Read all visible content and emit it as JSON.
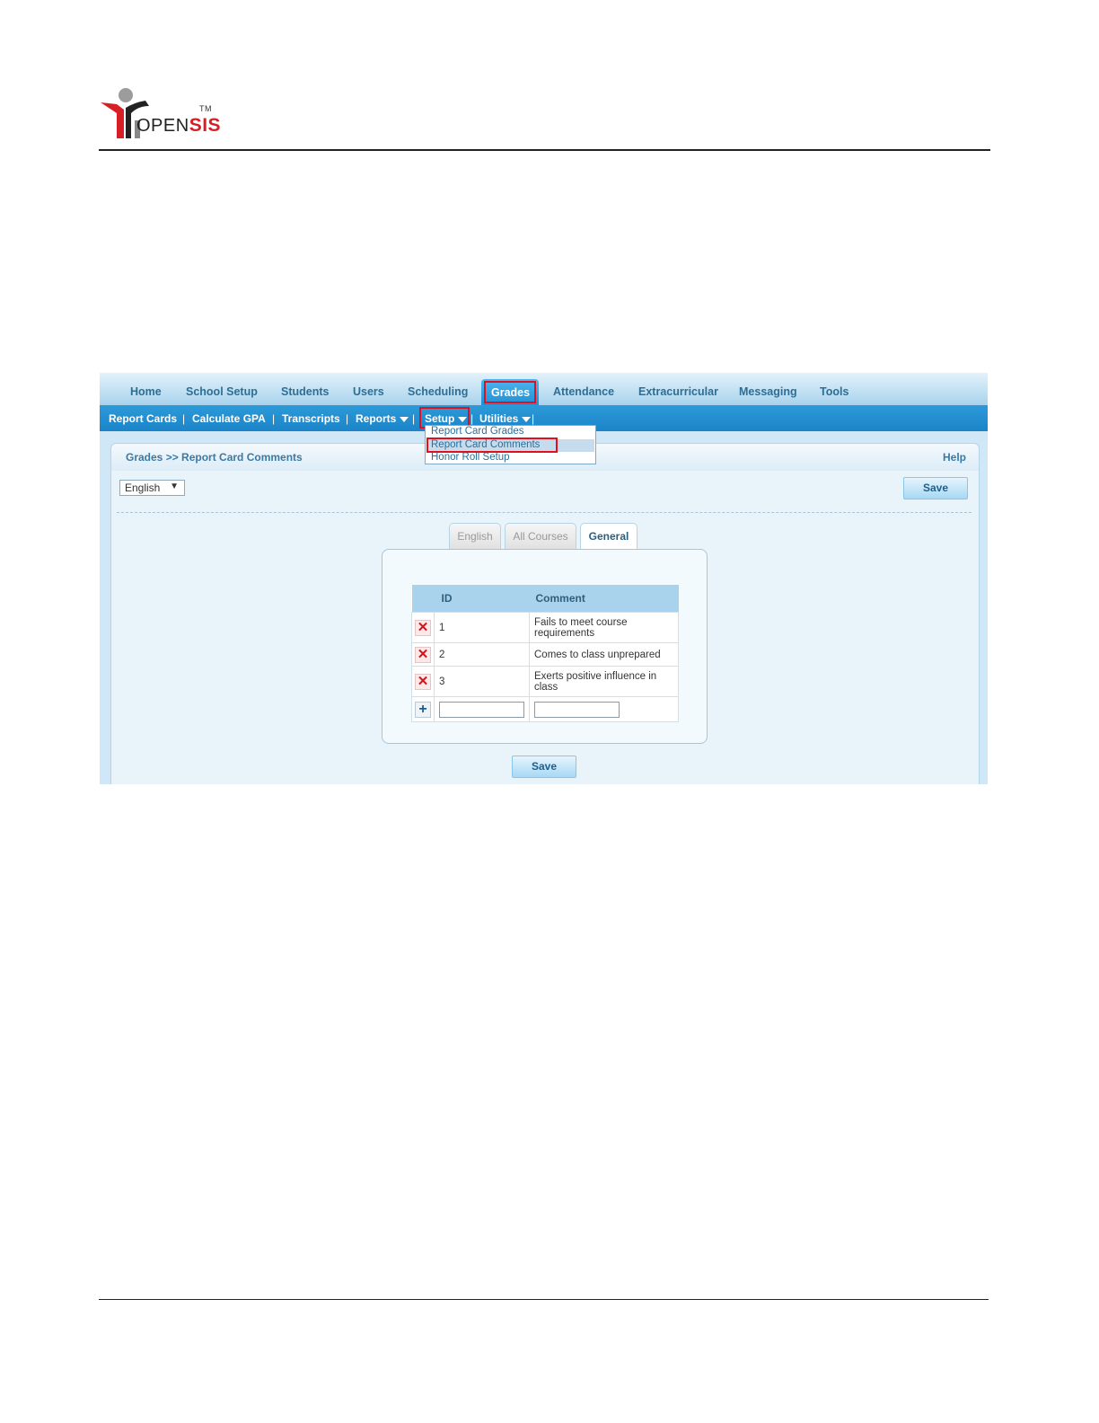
{
  "logo": {
    "text_open": "OPEN",
    "text_sis": "SIS",
    "tm": "TM"
  },
  "topnav": {
    "items": [
      "Home",
      "School Setup",
      "Students",
      "Users",
      "Scheduling",
      "Grades",
      "Attendance",
      "Extracurricular",
      "Messaging",
      "Tools"
    ],
    "active": "Grades"
  },
  "subnav": {
    "items": [
      "Report Cards",
      "Calculate GPA",
      "Transcripts",
      "Reports",
      "Setup",
      "Utilities"
    ],
    "separator": "|"
  },
  "setup_menu": {
    "options": [
      "Report Card Grades",
      "Report Card Comments",
      "Honor Roll Setup"
    ],
    "selected": "Report Card Comments"
  },
  "panel": {
    "breadcrumb": "Grades >> Report Card Comments",
    "help": "Help",
    "language_select": "English",
    "save_top": "Save",
    "save_bottom": "Save"
  },
  "tabs": [
    {
      "label": "English",
      "active": false
    },
    {
      "label": "All Courses",
      "active": false
    },
    {
      "label": "General",
      "active": true
    }
  ],
  "table": {
    "headers": [
      "ID",
      "Comment"
    ],
    "rows": [
      {
        "id": "1",
        "comment": "Fails to meet course requirements"
      },
      {
        "id": "2",
        "comment": "Comes to class unprepared"
      },
      {
        "id": "3",
        "comment": "Exerts positive influence in class"
      }
    ],
    "new_id": "",
    "new_comment": ""
  },
  "colors": {
    "highlight": "#e0101e",
    "nav_active": "#1f8fd4",
    "subnav": "#1b84c8"
  },
  "icons": {
    "delete": "close-icon",
    "add": "plus-icon",
    "caret": "caret-down-icon"
  }
}
